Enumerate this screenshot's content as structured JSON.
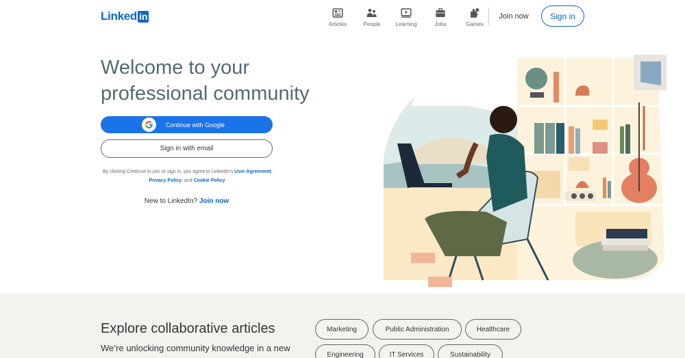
{
  "header": {
    "logo_text": "Linked",
    "logo_box": "in",
    "nav": [
      {
        "label": "Articles",
        "icon": "articles-icon"
      },
      {
        "label": "People",
        "icon": "people-icon"
      },
      {
        "label": "Learning",
        "icon": "learning-icon"
      },
      {
        "label": "Jobs",
        "icon": "jobs-icon"
      },
      {
        "label": "Games",
        "icon": "games-icon"
      }
    ],
    "join_now": "Join now",
    "sign_in": "Sign in"
  },
  "hero": {
    "headline": "Welcome to your professional community",
    "google_button": "Continue with Google",
    "email_button": "Sign in with email",
    "legal_prefix": "By clicking Continue to join or sign in, you agree to LinkedIn’s ",
    "user_agreement": "User Agreement",
    "sep1": ", ",
    "privacy_policy": "Privacy Policy",
    "sep2": ", and ",
    "cookie_policy": "Cookie Policy",
    "legal_suffix": ".",
    "new_to": "New to LinkedIn? ",
    "join_now_link": "Join now"
  },
  "explore": {
    "title": "Explore collaborative articles",
    "subtitle": "We’re unlocking community knowledge in a new",
    "topics": [
      "Marketing",
      "Public Administration",
      "Healthcare",
      "Engineering",
      "IT Services",
      "Sustainability"
    ]
  },
  "colors": {
    "brand": "#0a66c2",
    "google_blue": "#1a73e8",
    "headline": "#526a6e",
    "explore_bg": "#f3f2ef"
  }
}
